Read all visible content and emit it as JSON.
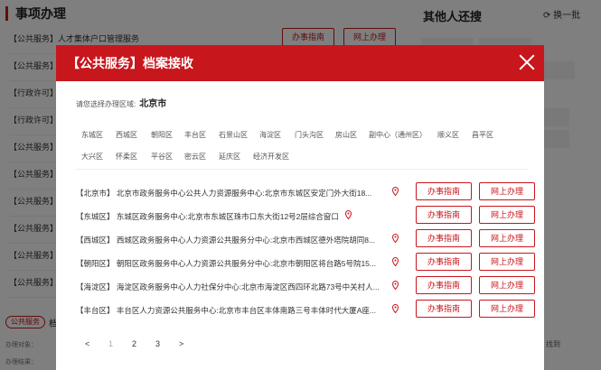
{
  "background": {
    "section_title": "事项办理",
    "sidebar_title": "其他人还搜",
    "refresh_label": "换一批",
    "rows": [
      {
        "text": "【公共服务】人才集体户口管理服务"
      },
      {
        "text": "【公共服务】"
      },
      {
        "text": "【行政许可】"
      },
      {
        "text": "【行政许可】"
      },
      {
        "text": "【公共服务】"
      },
      {
        "text": "【公共服务】"
      },
      {
        "text": "【公共服务】"
      },
      {
        "text": "【公共服务】"
      },
      {
        "text": "【公共服务】"
      },
      {
        "text": "【公共服务】"
      }
    ],
    "guide_btn": "办事指南",
    "online_btn": "网上办理",
    "tag": "公共服务",
    "tag_after": "档",
    "meta1": "办理对象：",
    "meta2": "办理结果：",
    "side_hint": "找到"
  },
  "modal": {
    "title": "【公共服务】档案接收",
    "region_prompt": "请您选择办理区域:",
    "region_value": "北京市",
    "districts_row1": [
      "东城区",
      "西城区",
      "朝阳区",
      "丰台区",
      "石景山区",
      "海淀区",
      "门头沟区",
      "房山区",
      "副中心（通州区）",
      "顺义区",
      "昌平区"
    ],
    "districts_row2": [
      "大兴区",
      "怀柔区",
      "平谷区",
      "密云区",
      "延庆区",
      "经济开发区"
    ],
    "items": [
      {
        "text": "【北京市】 北京市政务服务中心公共人力资源服务中心:北京市东城区安定门外大街18..."
      },
      {
        "text": "【东城区】 东城区政务服务中心:北京市东城区珠市口东大街12号2层综合窗口"
      },
      {
        "text": "【西城区】 西城区政务服务中心人力资源公共服务分中心:北京市西城区德外塔院胡同8..."
      },
      {
        "text": "【朝阳区】 朝阳区政务服务中心人力资源公共服务分中心:北京市朝阳区将台路5号院15..."
      },
      {
        "text": "【海淀区】 海淀区政务服务中心人力社保分中心:北京市海淀区西四环北路73号中关村人..."
      },
      {
        "text": "【丰台区】 丰台区人力资源公共服务中心:北京市丰台区丰体南路三号丰体时代大厦A座..."
      }
    ],
    "guide_label": "办事指南",
    "online_label": "网上办理",
    "pager": {
      "prev": "<",
      "pages": [
        "1",
        "2",
        "3"
      ],
      "next": ">"
    },
    "accent_color": "#c8161d",
    "icons": {
      "close": "close-icon",
      "location": "location-pin-icon",
      "refresh": "refresh-icon"
    }
  }
}
